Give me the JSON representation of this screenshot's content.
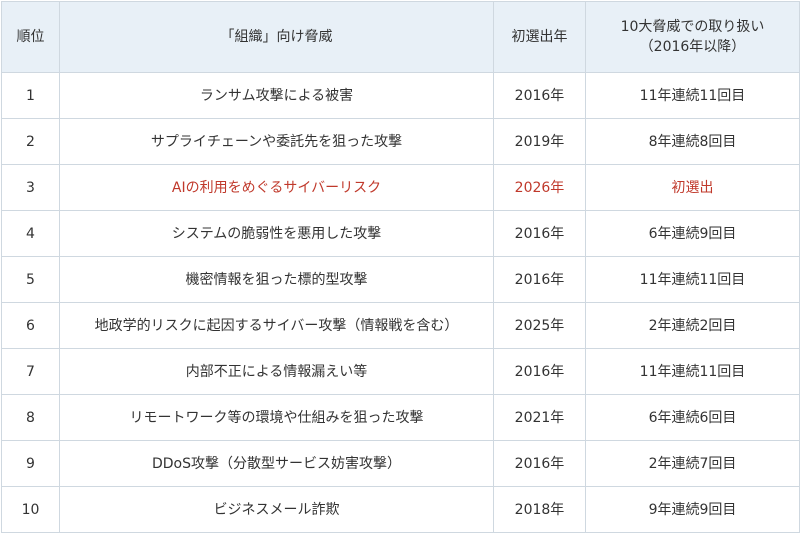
{
  "header": {
    "rank": "順位",
    "threat": "「組織」向け脅威",
    "first_year": "初選出年",
    "treatment_line1": "10大脅威での取り扱い",
    "treatment_line2": "（2016年以降）"
  },
  "rows": [
    {
      "rank": "1",
      "threat": "ランサム攻撃による被害",
      "first_year": "2016年",
      "treatment": "11年連続11回目",
      "highlight": false
    },
    {
      "rank": "2",
      "threat": "サプライチェーンや委託先を狙った攻撃",
      "first_year": "2019年",
      "treatment": "8年連続8回目",
      "highlight": false
    },
    {
      "rank": "3",
      "threat": "AIの利用をめぐるサイバーリスク",
      "first_year": "2026年",
      "treatment": "初選出",
      "highlight": true
    },
    {
      "rank": "4",
      "threat": "システムの脆弱性を悪用した攻撃",
      "first_year": "2016年",
      "treatment": "6年連続9回目",
      "highlight": false
    },
    {
      "rank": "5",
      "threat": "機密情報を狙った標的型攻撃",
      "first_year": "2016年",
      "treatment": "11年連続11回目",
      "highlight": false
    },
    {
      "rank": "6",
      "threat": "地政学的リスクに起因するサイバー攻撃（情報戦を含む）",
      "first_year": "2025年",
      "treatment": "2年連続2回目",
      "highlight": false
    },
    {
      "rank": "7",
      "threat": "内部不正による情報漏えい等",
      "first_year": "2016年",
      "treatment": "11年連続11回目",
      "highlight": false
    },
    {
      "rank": "8",
      "threat": "リモートワーク等の環境や仕組みを狙った攻撃",
      "first_year": "2021年",
      "treatment": "6年連続6回目",
      "highlight": false
    },
    {
      "rank": "9",
      "threat": "DDoS攻撃（分散型サービス妨害攻撃）",
      "first_year": "2016年",
      "treatment": "2年連続7回目",
      "highlight": false
    },
    {
      "rank": "10",
      "threat": "ビジネスメール詐欺",
      "first_year": "2018年",
      "treatment": "9年連続9回目",
      "highlight": false
    }
  ],
  "colors": {
    "header_bg": "#e8f0f7",
    "border": "#cfd8e0",
    "text": "#333333",
    "highlight_text": "#c0392b"
  }
}
